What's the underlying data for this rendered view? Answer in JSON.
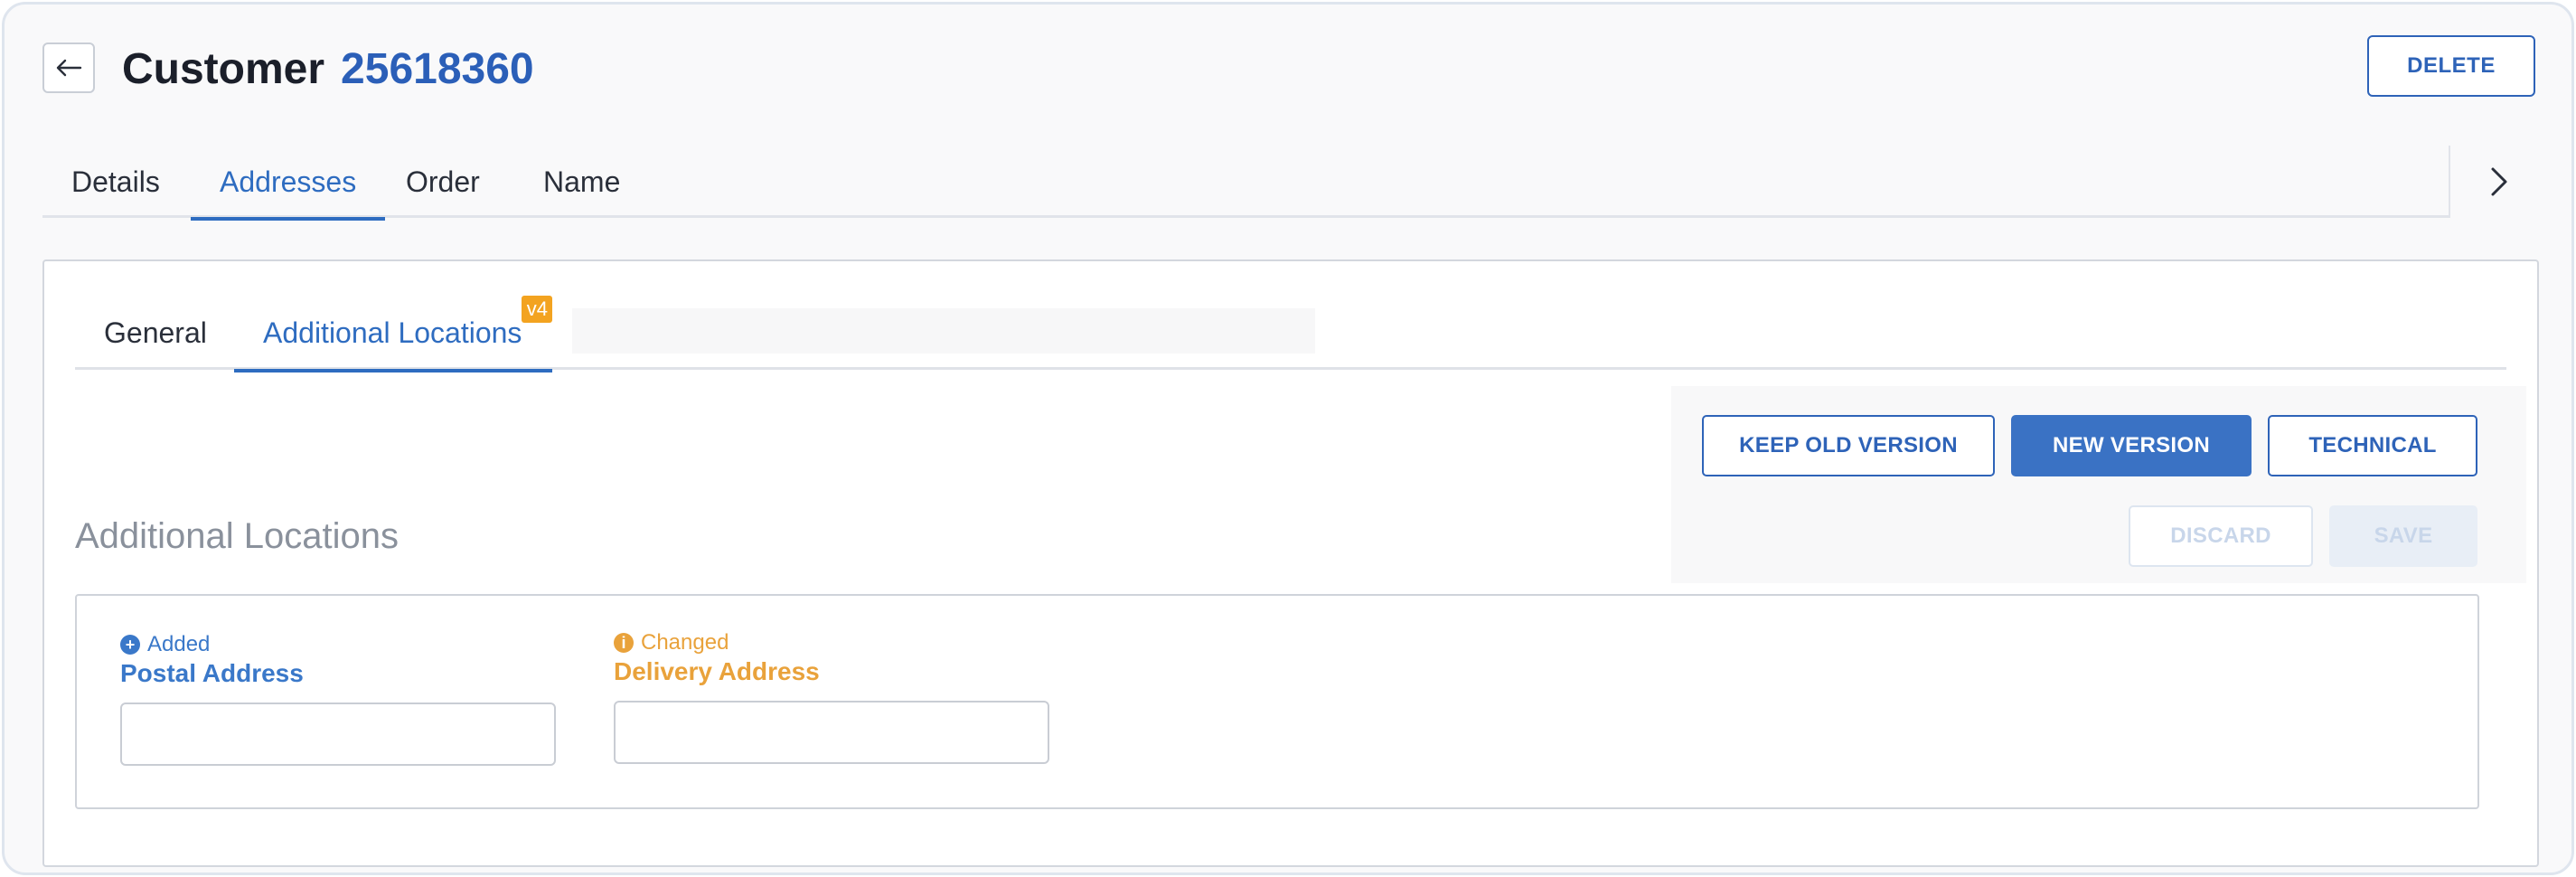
{
  "header": {
    "title_label": "Customer",
    "customer_id": "25618360",
    "delete_label": "DELETE"
  },
  "top_tabs": [
    {
      "label": "Details",
      "active": false
    },
    {
      "label": "Addresses",
      "active": true
    },
    {
      "label": "Order",
      "active": false
    },
    {
      "label": "Name",
      "active": false
    }
  ],
  "sub_tabs": [
    {
      "label": "General",
      "active": false
    },
    {
      "label": "Additional Locations",
      "active": true,
      "badge": "v4"
    }
  ],
  "actions": {
    "keep_old_version": "KEEP OLD VERSION",
    "new_version": "NEW VERSION",
    "technical": "TECHNICAL",
    "discard": "DISCARD",
    "save": "SAVE"
  },
  "section": {
    "title": "Additional Locations"
  },
  "fields": [
    {
      "status": "Added",
      "label": "Postal Address",
      "value": "",
      "status_icon": "plus-circle-icon"
    },
    {
      "status": "Changed",
      "label": "Delivery Address",
      "value": "",
      "status_icon": "info-circle-icon"
    }
  ],
  "colors": {
    "accent": "#2e6cc0",
    "added": "#3a78c9",
    "changed": "#e9a23b",
    "badge": "#f3a320"
  }
}
